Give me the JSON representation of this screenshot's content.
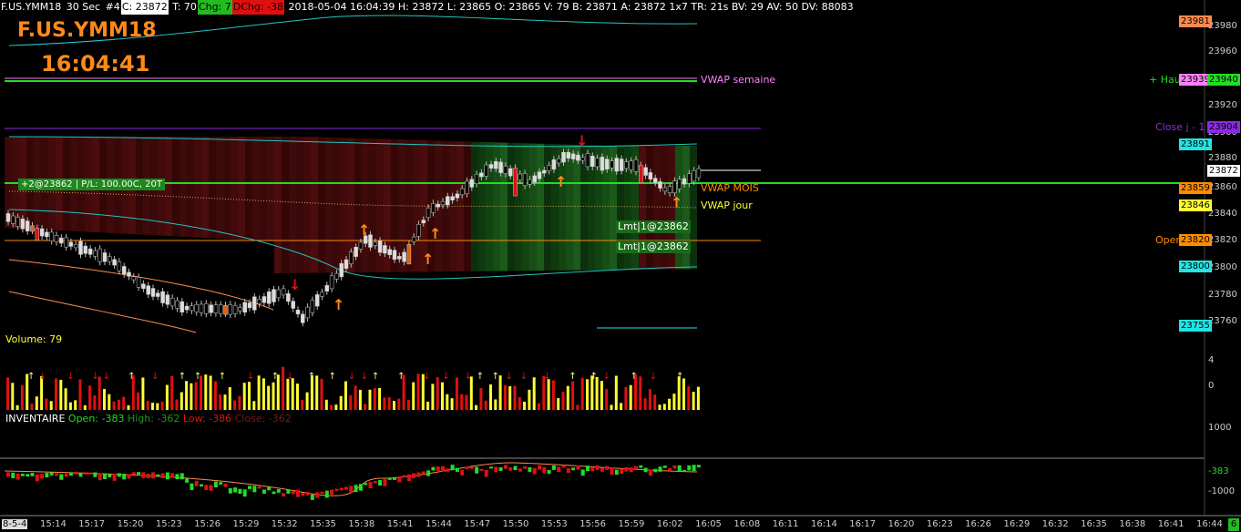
{
  "header": {
    "symbol": "F.US.YMM18",
    "interval": "30 Sec",
    "bars_label": "#4",
    "close": "C: 23872",
    "ticks": "T: 70",
    "chg": "Chg: 7",
    "dchg": "DChg: -38",
    "details": "2018-05-04 16:04:39 H: 23872 L: 23865 O: 23865 V: 79 B: 23871 A: 23872 1x7 TR: 21s BV: 29 AV: 50 DV: 88083"
  },
  "overlay": {
    "symbol_big": "F.US.YMM18",
    "time_big": "16:04:41"
  },
  "price_axis": {
    "ticks": [
      "23980",
      "23960",
      "23940",
      "23920",
      "23900",
      "23880",
      "23860",
      "23840",
      "23820",
      "23800",
      "23780",
      "23760"
    ]
  },
  "price_labels": [
    {
      "text": "23981",
      "bg": "#ff8a50"
    },
    {
      "text": "23939",
      "bg": "#ff80ff"
    },
    {
      "text": "23940",
      "bg": "#22dd22"
    },
    {
      "text": "23904",
      "bg": "#8a2be2"
    },
    {
      "text": "23891",
      "bg": "#22e5e5"
    },
    {
      "text": "23872",
      "bg": "#ffffff"
    },
    {
      "text": "23859",
      "bg": "#ff8c00"
    },
    {
      "text": "23846",
      "bg": "#ffff33"
    },
    {
      "text": "23820",
      "bg": "#ff8c00"
    },
    {
      "text": "23800",
      "bg": "#22e5e5"
    },
    {
      "text": "23755",
      "bg": "#22e5e5"
    }
  ],
  "line_tags": {
    "vwap_semaine": "VWAP semaine",
    "vwap_mois": "VWAP MOIS",
    "vwap_jour": "VWAP jour",
    "haut": "+ Hau",
    "close_j1": "Close j - 1",
    "open_j1": "Open j - 1"
  },
  "position_label": "+2@23862 | P/L: 100.00C, 20T",
  "orders": [
    "Lmt|1@23862",
    "Lmt|1@23862"
  ],
  "volume": {
    "label": "Volume: 79",
    "axis": [
      "4",
      "0",
      "1000"
    ]
  },
  "inventory": {
    "title": "INVENTAIRE",
    "open": "Open: -383",
    "high": "High: -362",
    "low": "Low: -386",
    "close": "Close: -362",
    "axis": [
      "-383",
      "-1000"
    ]
  },
  "time_axis": {
    "start": "8-5-4",
    "ticks": [
      "15:14",
      "15:17",
      "15:20",
      "15:23",
      "15:26",
      "15:29",
      "15:32",
      "15:35",
      "15:38",
      "15:41",
      "15:44",
      "15:47",
      "15:50",
      "15:53",
      "15:56",
      "15:59",
      "16:02",
      "16:05",
      "16:08",
      "16:11",
      "16:14",
      "16:17",
      "16:20",
      "16:23",
      "16:26",
      "16:29",
      "16:32",
      "16:35",
      "16:38",
      "16:41",
      "16:44"
    ],
    "end_badge": "6"
  },
  "colors": {
    "up": "#d8d8d8",
    "down": "#d8d8d8",
    "vol_up": "#ffff33",
    "vol_down": "#e01010",
    "arrow_up": "#ff8a1a",
    "arrow_down": "#e01010",
    "vwap_semaine": "#ff80ff",
    "vwap_green": "#22dd22"
  }
}
